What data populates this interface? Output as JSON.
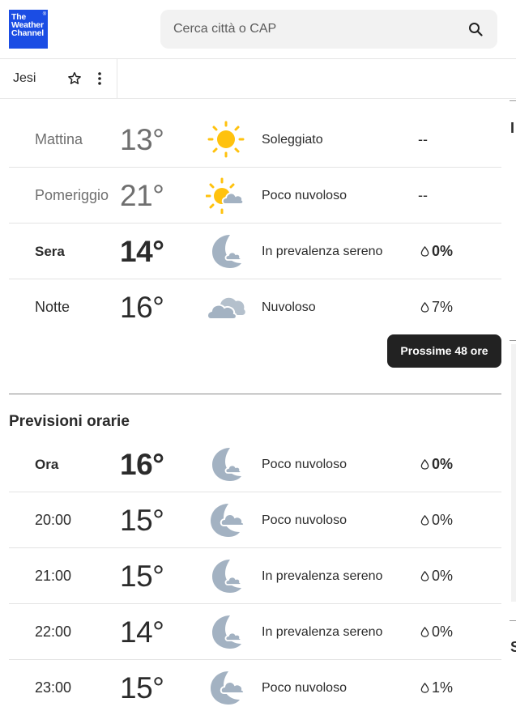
{
  "header": {
    "logo": {
      "line1": "The",
      "line2": "Weather",
      "line3": "Channel",
      "mark": "®"
    },
    "search": {
      "placeholder": "Cerca città o CAP",
      "icon": "search-icon"
    }
  },
  "location": {
    "name": "Jesi",
    "favorite_icon": "star-icon",
    "menu_icon": "kebab-icon"
  },
  "daypart": {
    "rows": [
      {
        "label": "Mattina",
        "temp": "13°",
        "icon": "sun-icon",
        "desc": "Soleggiato",
        "precip": "--"
      },
      {
        "label": "Pomeriggio",
        "temp": "21°",
        "icon": "partly-cloudy-day-icon",
        "desc": "Poco nuvoloso",
        "precip": "--"
      },
      {
        "label": "Sera",
        "temp": "14°",
        "icon": "moon-clear-icon",
        "desc": "In prevalenza sereno",
        "precip": "0%"
      },
      {
        "label": "Notte",
        "temp": "16°",
        "icon": "cloud-icon",
        "desc": "Nuvoloso",
        "precip": "7%"
      }
    ],
    "next_button": "Prossime 48 ore"
  },
  "hourly": {
    "title": "Previsioni orarie",
    "rows": [
      {
        "label": "Ora",
        "temp": "16°",
        "icon": "moon-mostly-clear-icon",
        "desc": "Poco nuvoloso",
        "precip": "0%"
      },
      {
        "label": "20:00",
        "temp": "15°",
        "icon": "moon-partly-cloudy-icon",
        "desc": "Poco nuvoloso",
        "precip": "0%"
      },
      {
        "label": "21:00",
        "temp": "15°",
        "icon": "moon-mostly-clear-icon",
        "desc": "In prevalenza sereno",
        "precip": "0%"
      },
      {
        "label": "22:00",
        "temp": "14°",
        "icon": "moon-mostly-clear-icon",
        "desc": "In prevalenza sereno",
        "precip": "0%"
      },
      {
        "label": "23:00",
        "temp": "15°",
        "icon": "moon-partly-cloudy-icon",
        "desc": "Poco nuvoloso",
        "precip": "1%"
      }
    ]
  },
  "right_edge": {
    "fragment_1": "I",
    "fragment_2": "S"
  },
  "colors": {
    "sun": "#ffc20e",
    "moon": "#a3b2c2",
    "cloud": "#b4c0cc",
    "logo_bg": "#1b4de4",
    "button_bg": "#222222"
  }
}
